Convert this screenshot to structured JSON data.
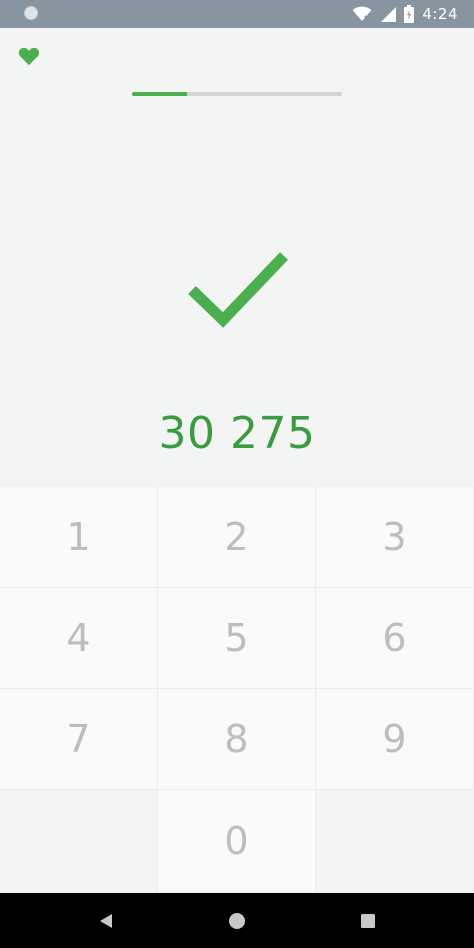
{
  "status_bar": {
    "time": "4:24",
    "icons": [
      "notification-dot-icon",
      "wifi-icon",
      "signal-icon",
      "battery-icon"
    ]
  },
  "header": {
    "favorite_icon": "heart-icon",
    "progress_fraction": 0.26
  },
  "result": {
    "icon": "checkmark-icon",
    "amount": "30 275"
  },
  "keypad": {
    "keys": [
      "1",
      "2",
      "3",
      "4",
      "5",
      "6",
      "7",
      "8",
      "9",
      "",
      "0",
      ""
    ]
  },
  "nav_bar": {
    "buttons": [
      "back-icon",
      "home-icon",
      "recents-icon"
    ]
  },
  "colors": {
    "accent_green": "#4cae4f",
    "amount_green": "#3c9a41",
    "status_bar_bg": "#8894a0",
    "key_text": "#bdbdbd"
  }
}
